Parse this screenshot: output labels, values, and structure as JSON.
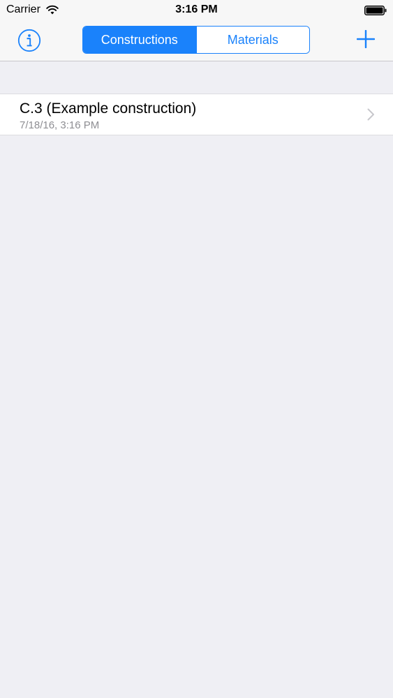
{
  "status_bar": {
    "carrier": "Carrier",
    "time": "3:16 PM",
    "icons": [
      "wifi-icon",
      "battery-icon"
    ]
  },
  "nav_bar": {
    "left_icon": "info-icon",
    "right_icon": "plus-icon",
    "segments": [
      {
        "label": "Constructions",
        "selected": true
      },
      {
        "label": "Materials",
        "selected": false
      }
    ]
  },
  "list": {
    "items": [
      {
        "title": "C.3 (Example construction)",
        "subtitle": "7/18/16, 3:16 PM",
        "accessory": "chevron-right-icon"
      }
    ]
  },
  "colors": {
    "accent": "#1a82fb",
    "background": "#efeff4",
    "bar_background": "#f7f7f7",
    "subtitle": "#8e8e93",
    "chevron": "#c7c7cc"
  }
}
